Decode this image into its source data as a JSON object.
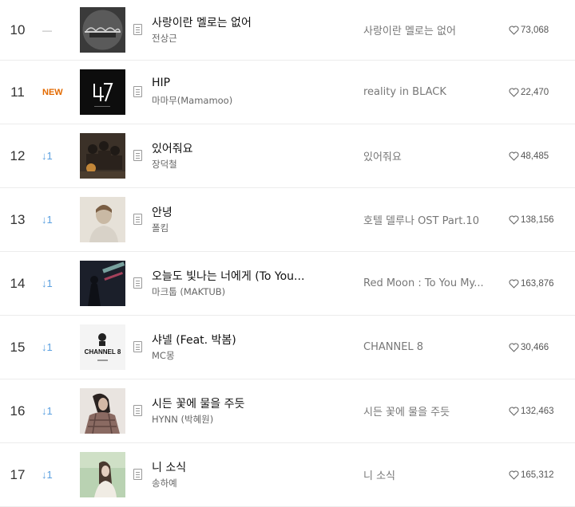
{
  "colors": {
    "new_badge": "#e36a00",
    "down_arrow": "#5aa0e0",
    "same": "#aaaaaa",
    "row_border": "#ececec"
  },
  "rows": [
    {
      "rank": "10",
      "change": "—",
      "change_type": "same",
      "title": "사랑이란 멜로는 없어",
      "artist": "전상근",
      "album": "사랑이란 멜로는 없어",
      "likes": "73,068",
      "art": "art-dark-bridge"
    },
    {
      "rank": "11",
      "change": "NEW",
      "change_type": "new",
      "title": "HIP",
      "artist": "마마무(Mamamoo)",
      "album": "reality in BLACK",
      "likes": "22,470",
      "art": "art-black-47"
    },
    {
      "rank": "12",
      "change": "↓1",
      "change_type": "down",
      "title": "있어줘요",
      "artist": "장덕철",
      "album": "있어줘요",
      "likes": "48,485",
      "art": "art-band-photo"
    },
    {
      "rank": "13",
      "change": "↓1",
      "change_type": "down",
      "title": "안녕",
      "artist": "폴킴",
      "album": "호텔 델루나 OST Part.10",
      "likes": "138,156",
      "art": "art-portrait-light"
    },
    {
      "rank": "14",
      "change": "↓1",
      "change_type": "down",
      "title": "오늘도 빛나는 너에게 (To You...",
      "artist": "마크툽 (MAKTUB)",
      "album": "Red Moon : To You My...",
      "likes": "163,876",
      "art": "art-dark-neon"
    },
    {
      "rank": "15",
      "change": "↓1",
      "change_type": "down",
      "title": "샤넬 (Feat. 박봄)",
      "artist": "MC몽",
      "album": "CHANNEL 8",
      "likes": "30,466",
      "art": "art-channel8",
      "art_text": "CHANNEL 8"
    },
    {
      "rank": "16",
      "change": "↓1",
      "change_type": "down",
      "title": "시든 꽃에 물을 주듯",
      "artist": "HYNN (박혜원)",
      "album": "시든 꽃에 물을 주듯",
      "likes": "132,463",
      "art": "art-woman-plaid"
    },
    {
      "rank": "17",
      "change": "↓1",
      "change_type": "down",
      "title": "니 소식",
      "artist": "송하예",
      "album": "니 소식",
      "likes": "165,312",
      "art": "art-green-portrait"
    }
  ]
}
